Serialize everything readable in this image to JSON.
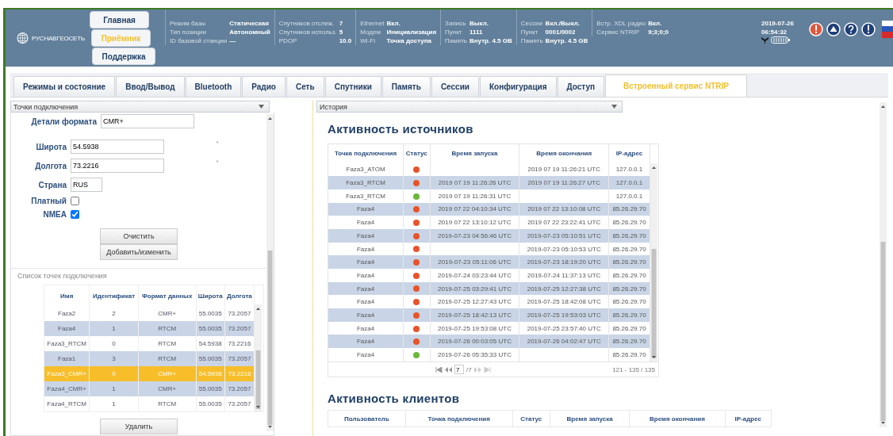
{
  "header": {
    "logo": "РУСНАВГЕОСЕТЬ",
    "nav": [
      {
        "label": "Главная",
        "selected": false
      },
      {
        "label": "Приёмник",
        "selected": true
      },
      {
        "label": "Поддержка",
        "selected": false
      }
    ],
    "status_groups": [
      {
        "items": [
          {
            "label": "Режим базы",
            "value": "Статическая"
          },
          {
            "label": "Тип позиции",
            "value": "Автономный"
          },
          {
            "label": "ID базовой станции",
            "value": "—"
          }
        ]
      },
      {
        "items": [
          {
            "label": "Спутников отслеж.",
            "value": "7"
          },
          {
            "label": "Спутников использ.",
            "value": "5"
          },
          {
            "label": "PDOP",
            "value": "10.0"
          }
        ]
      },
      {
        "items": [
          {
            "label": "Ethernet",
            "value": "Вкл."
          },
          {
            "label": "Модем",
            "value": "Инициализация"
          },
          {
            "label": "Wi-Fi",
            "value": "Точка доступа"
          }
        ]
      },
      {
        "items": [
          {
            "label": "Запись",
            "value": "Выкл."
          },
          {
            "label": "Пункт",
            "value": "1111"
          },
          {
            "label": "Память",
            "value": "Внутр. 4.5 GB"
          }
        ]
      },
      {
        "items": [
          {
            "label": "Сессии",
            "value": "Вкл./Выкл."
          },
          {
            "label": "Пункт",
            "value": "0001/0002"
          },
          {
            "label": "Память",
            "value": "Внутр. 4.5 GB"
          }
        ]
      },
      {
        "items": [
          {
            "label": "Встр. XDL радио",
            "value": "Вкл."
          },
          {
            "label": "Сервис NTRIP",
            "value": "9;3;0;0"
          }
        ]
      }
    ],
    "date": "2019-07-26",
    "time": "06:54:32"
  },
  "tabs": [
    {
      "label": "Режимы и состояние",
      "selected": false
    },
    {
      "label": "Ввод/Вывод",
      "selected": false
    },
    {
      "label": "Bluetooth",
      "selected": false
    },
    {
      "label": "Радио",
      "selected": false
    },
    {
      "label": "Сеть",
      "selected": false
    },
    {
      "label": "Спутники",
      "selected": false
    },
    {
      "label": "Память",
      "selected": false
    },
    {
      "label": "Сессии",
      "selected": false
    },
    {
      "label": "Конфигурация",
      "selected": false
    },
    {
      "label": "Доступ",
      "selected": false
    },
    {
      "label": "Встроенный сервис NTRIP",
      "selected": true
    }
  ],
  "left_panel": {
    "dropdown": "Точки подключения",
    "fields": [
      {
        "label": "Детали формата",
        "value": "CMR+"
      },
      {
        "label": "Широта",
        "value": "54.5938",
        "note": "*"
      },
      {
        "label": "Долгота",
        "value": "73.2216",
        "note": "*"
      },
      {
        "label": "Страна",
        "value": "RUS"
      }
    ],
    "checkboxes": [
      {
        "label": "Платный",
        "checked": false
      },
      {
        "label": "NMEA",
        "checked": true
      }
    ],
    "buttons": [
      "Очистить",
      "Добавить/изменить"
    ],
    "list_caption": "Список точек подключения",
    "table": {
      "columns": [
        "Имя",
        "Идентификат",
        "Формат данных",
        "Широта",
        "Долгота"
      ],
      "rows": [
        {
          "cells": [
            "Faza2",
            "2",
            "CMR+",
            "55.0035",
            "73.2057"
          ],
          "selected": false
        },
        {
          "cells": [
            "Faza4",
            "1",
            "RTCM",
            "55.0035",
            "73.2057"
          ],
          "selected": false
        },
        {
          "cells": [
            "Faza3_RTCM",
            "0",
            "RTCM",
            "54.5938",
            "73.2216"
          ],
          "selected": false
        },
        {
          "cells": [
            "Faza1",
            "3",
            "RTCM",
            "55.0035",
            "73.2057"
          ],
          "selected": false
        },
        {
          "cells": [
            "Faza3_CMR+",
            "0",
            "CMR+",
            "54.5938",
            "73.2216"
          ],
          "selected": true
        },
        {
          "cells": [
            "Faza4_CMR+",
            "1",
            "CMR+",
            "55.0035",
            "73.2057"
          ],
          "selected": false
        },
        {
          "cells": [
            "Faza4_RTCM",
            "1",
            "RTCM",
            "55.0035",
            "73.2057"
          ],
          "selected": false
        }
      ]
    },
    "delete_button": "Удалить"
  },
  "right_panel": {
    "dropdown": "История",
    "sources": {
      "title": "Активность источников",
      "columns": [
        "Точка подключения",
        "Статус",
        "Время запуска",
        "Время окончания",
        "IP-адрес"
      ],
      "rows": [
        {
          "mount": "Faza3_ATOM",
          "color": "#e8542a",
          "end": "2019 07 19 11:26:21 UTC",
          "ip": "127.0.0.1"
        },
        {
          "mount": "Faza3_RTCM",
          "color": "#e8542a",
          "start": "2019 07 19 11:26:26 UTC",
          "end": "2019 07 19 11:26:27 UTC",
          "ip": "127.0.0.1"
        },
        {
          "mount": "Faza3_RTCM",
          "color": "#6cb83a",
          "start": "2019 07 19 11:26:31 UTC",
          "ip": "127.0.0.1"
        },
        {
          "mount": "Faza4",
          "color": "#e8542a",
          "start": "2019 07 22 04:10:34 UTC",
          "end": "2019 07 22 13:10:08 UTC",
          "ip": "85.26.29.70"
        },
        {
          "mount": "Faza4",
          "color": "#e8542a",
          "start": "2019 07 22 13:10:12 UTC",
          "end": "2019 07 22 23:22:41 UTC",
          "ip": "85.26.29.70"
        },
        {
          "mount": "Faza4",
          "color": "#e8542a",
          "start": "2019-07-23 04:56:46 UTC",
          "end": "2019-07-23 05:10:51 UTC",
          "ip": "85.26.29.70"
        },
        {
          "mount": "Faza4",
          "color": "#e8542a",
          "end": "2019-07-23 05:10:53 UTC",
          "ip": "85.26.29.70"
        },
        {
          "mount": "Faza4",
          "color": "#e8542a",
          "start": "2019-07-23 05:11:06 UTC",
          "end": "2019-07-23 18:19:20 UTC",
          "ip": "85.26.29.70"
        },
        {
          "mount": "Faza4",
          "color": "#e8542a",
          "start": "2019-07-24 03:23:44 UTC",
          "end": "2019-07-24 11:37:13 UTC",
          "ip": "85.26.29.70"
        },
        {
          "mount": "Faza4",
          "color": "#e8542a",
          "start": "2019-07-25 03:29:41 UTC",
          "end": "2019-07-25 12:27:38 UTC",
          "ip": "85.26.29.70"
        },
        {
          "mount": "Faza4",
          "color": "#e8542a",
          "start": "2019-07-25 12:27:43 UTC",
          "end": "2019-07-25 18:42:08 UTC",
          "ip": "85.26.29.70"
        },
        {
          "mount": "Faza4",
          "color": "#e8542a",
          "start": "2019-07-25 18:42:13 UTC",
          "end": "2019-07-25 19:53:03 UTC",
          "ip": "85.26.29.70"
        },
        {
          "mount": "Faza4",
          "color": "#e8542a",
          "start": "2019-07-25 19:53:08 UTC",
          "end": "2019-07-25 23:57:40 UTC",
          "ip": "85.26.29.70"
        },
        {
          "mount": "Faza4",
          "color": "#e8542a",
          "start": "2019-07-26 00:03:05 UTC",
          "end": "2019-07-26 04:02:47 UTC",
          "ip": "85.26.29.70"
        },
        {
          "mount": "Faza4",
          "color": "#6cb83a",
          "start": "2019-07-26 05:35:33 UTC",
          "ip": "85.26.29.70"
        }
      ],
      "page": "7",
      "page_total": "/7",
      "range": "121 - 135 / 135"
    },
    "clients": {
      "title": "Активность клиентов",
      "columns": [
        "Пользователь",
        "Точка подключения",
        "Статус",
        "Время запуска",
        "Время окончания",
        "IP-адрес"
      ]
    }
  }
}
